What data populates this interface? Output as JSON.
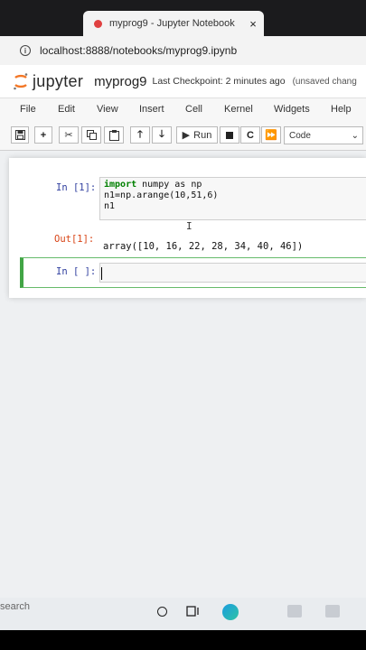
{
  "browser": {
    "tab_title": "myprog9 - Jupyter Notebook",
    "tab_close": "×",
    "url": "localhost:8888/notebooks/myprog9.ipynb"
  },
  "jupyter": {
    "brand": "jupyter",
    "notebook_name": "myprog9",
    "checkpoint": "Last Checkpoint: 2 minutes ago",
    "unsaved": "(unsaved chang"
  },
  "menu": {
    "items": [
      "File",
      "Edit",
      "View",
      "Insert",
      "Cell",
      "Kernel",
      "Widgets",
      "Help"
    ]
  },
  "toolbar": {
    "run_label": "Run",
    "cell_type": "Code"
  },
  "cells": {
    "c1_prompt": "In [1]:",
    "c1_kw": "import",
    "c1_line1_rest": " numpy as np",
    "c1_line2": "n1=np.arange(10,51,6)",
    "c1_line3": "n1",
    "out1_prompt": "Out[1]:",
    "out1_text": "array([10, 16, 22, 28, 34, 40, 46])",
    "c2_prompt": "In [ ]:"
  },
  "taskbar": {
    "search_label": "search"
  }
}
